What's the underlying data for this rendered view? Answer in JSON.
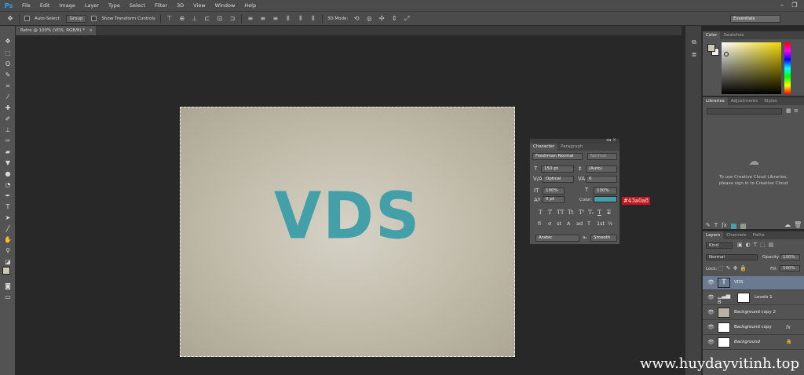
{
  "app": {
    "logo": "Ps"
  },
  "menu": [
    "File",
    "Edit",
    "Image",
    "Layer",
    "Type",
    "Select",
    "Filter",
    "3D",
    "View",
    "Window",
    "Help"
  ],
  "window_controls": {
    "minimize": "–",
    "restore": "❐"
  },
  "options_bar": {
    "auto_select_label": "Auto-Select:",
    "auto_select_value": "Group",
    "transform_label": "Show Transform Controls",
    "mode_3d_label": "3D Mode:",
    "workspace": "Essentials"
  },
  "document_tab": {
    "title": "Retro @ 100% (VDS, RGB/8) *",
    "close": "×"
  },
  "canvas": {
    "text": "VDS",
    "text_color": "#43a0a8",
    "background": "#c4bfae"
  },
  "character_panel": {
    "tabs": [
      "Character",
      "Paragraph"
    ],
    "font_family": "Freshman Normal",
    "font_style": "Normal",
    "font_size": "150 pt",
    "leading": "(Auto)",
    "kerning": "Optical",
    "tracking": "0",
    "vertical_scale": "100%",
    "horizontal_scale": "100%",
    "baseline_shift": "0 pt",
    "color_label": "Color:",
    "color_value": "#43a0a8",
    "style_buttons": [
      "T",
      "T",
      "TT",
      "Tt",
      "T¹",
      "T₁",
      "T",
      "T"
    ],
    "opentype_buttons": [
      "fi",
      "ơ",
      "st",
      "A",
      "ad",
      "T",
      "1st",
      "½"
    ],
    "language": "Arabic",
    "anti_alias_label": "aₐ",
    "anti_alias": "Smooth"
  },
  "hex_annotation": "#43a0a8",
  "color_panel": {
    "tabs": [
      "Color",
      "Swatches"
    ],
    "foreground": "#cdc8b4",
    "background": "#f2f0ea"
  },
  "libraries_panel": {
    "tabs": [
      "Libraries",
      "Adjustments",
      "Styles"
    ],
    "message_line1": "To use Creative Cloud Libraries,",
    "message_line2": "please sign in to Creative Cloud"
  },
  "layers_panel": {
    "tabs": [
      "Layers",
      "Channels",
      "Paths"
    ],
    "filter_kind": "Kind",
    "blend_mode": "Normal",
    "opacity_label": "Opacity:",
    "opacity": "100%",
    "lock_label": "Lock:",
    "fill_label": "Fill:",
    "fill": "100%",
    "layers": [
      {
        "name": "VDS",
        "selected": true
      },
      {
        "name": "Levels 1",
        "selected": false
      },
      {
        "name": "Background copy 2",
        "selected": false
      },
      {
        "name": "Background copy",
        "selected": false,
        "fx": "fx"
      },
      {
        "name": "Background",
        "selected": false
      }
    ]
  },
  "watermark": "www.huydayvitinh.top"
}
